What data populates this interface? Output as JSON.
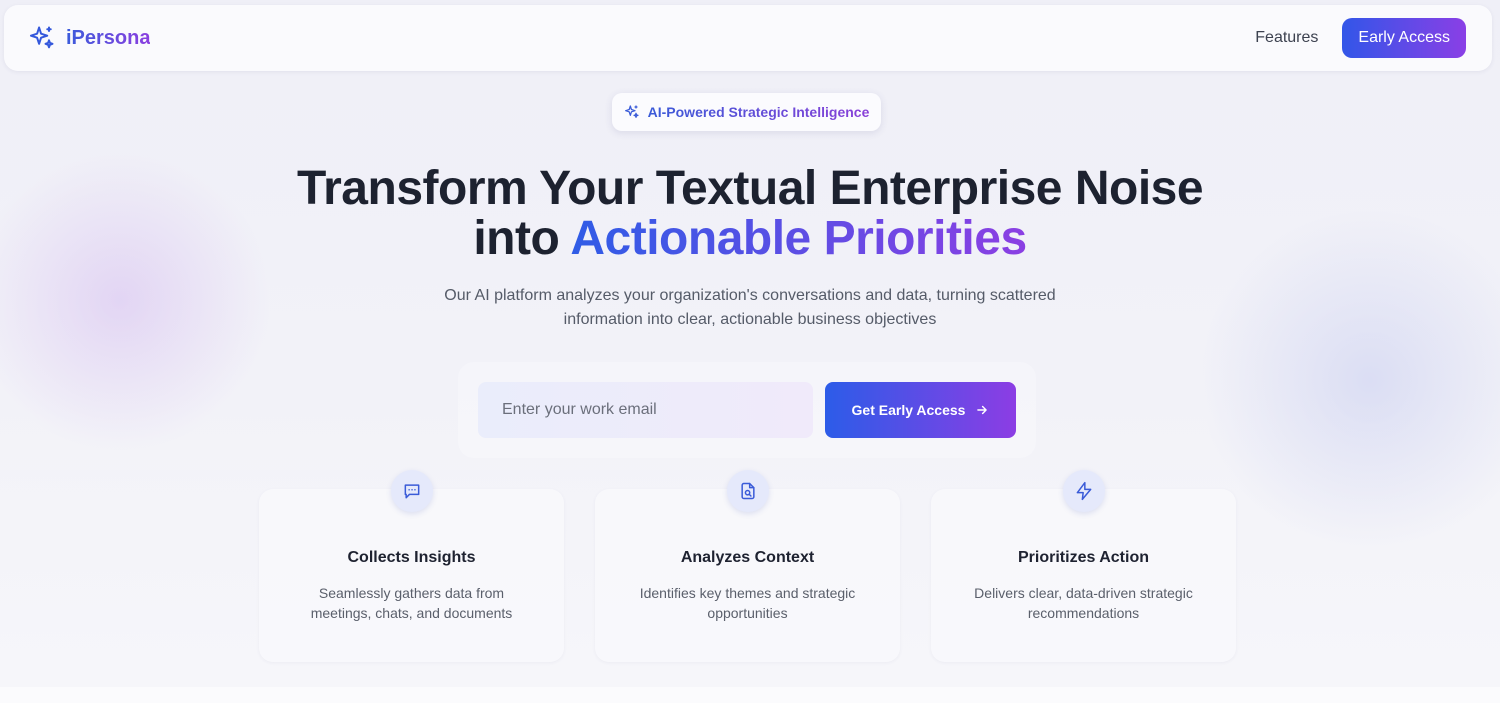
{
  "brand": {
    "name": "iPersona",
    "icon": "sparkles-icon"
  },
  "nav": {
    "features_label": "Features",
    "cta_label": "Early Access"
  },
  "badge": {
    "icon": "sparkles-icon",
    "text": "AI-Powered Strategic Intelligence"
  },
  "hero": {
    "headline_line1": "Transform Your Textual Enterprise Noise",
    "headline_line2_prefix": "into",
    "headline_line2_highlight": "Actionable Priorities",
    "subtitle": "Our AI platform analyzes your organization's conversations and data, turning scattered information into clear, actionable business objectives"
  },
  "signup": {
    "email_placeholder": "Enter your work email",
    "email_value": "",
    "submit_label": "Get Early Access",
    "submit_icon": "arrow-right-icon"
  },
  "features": [
    {
      "icon": "message-square-icon",
      "title": "Collects Insights",
      "description": "Seamlessly gathers data from meetings, chats, and documents"
    },
    {
      "icon": "file-search-icon",
      "title": "Analyzes Context",
      "description": "Identifies key themes and strategic opportunities"
    },
    {
      "icon": "zap-icon",
      "title": "Prioritizes Action",
      "description": "Delivers clear, data-driven strategic recommendations"
    }
  ],
  "colors": {
    "accent_start": "#2f5ce6",
    "accent_end": "#8b3fe3",
    "heading": "#1d2230",
    "body_text": "#555b68"
  }
}
